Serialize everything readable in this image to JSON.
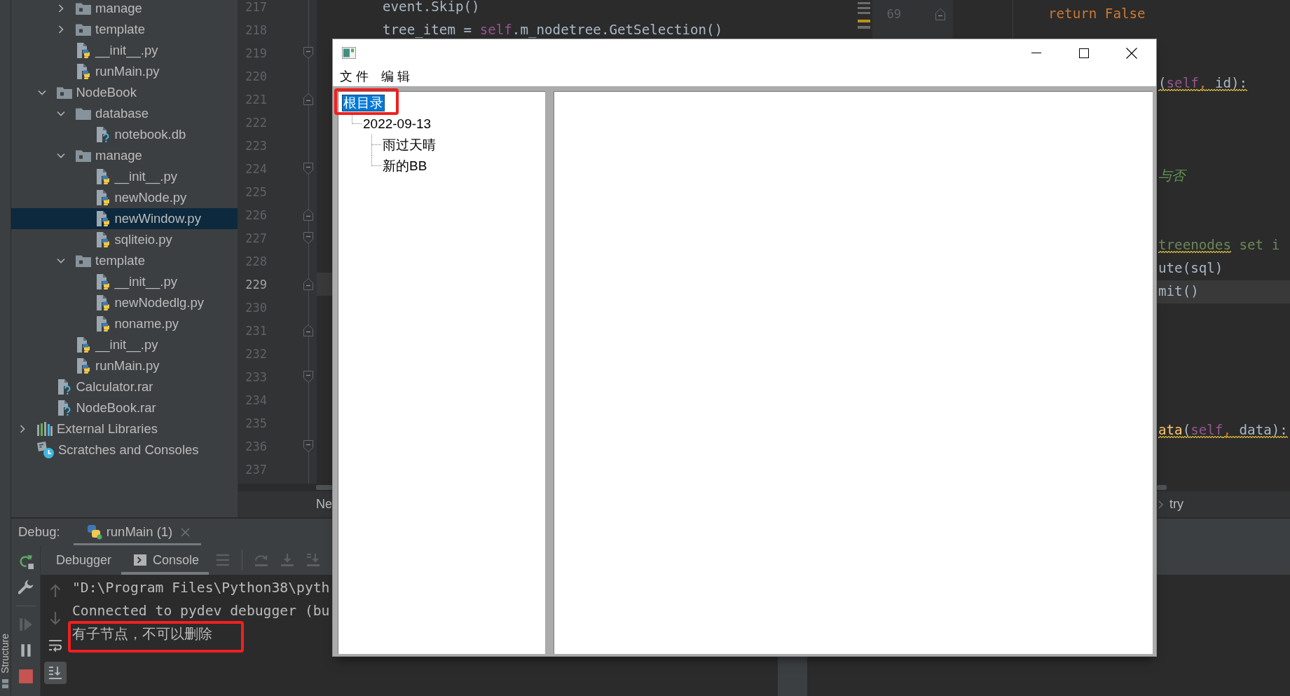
{
  "side_tab": "Structure",
  "project_tree": {
    "items": [
      {
        "children": [
          {
            "children": [
              {
                "label": "manage",
                "kind": "package",
                "expanded": false,
                "selected": false
              },
              {
                "label": "template",
                "kind": "package",
                "expanded": false,
                "selected": false
              },
              {
                "label": "__init__.py",
                "kind": "python",
                "selected": false
              },
              {
                "label": "runMain.py",
                "kind": "python",
                "selected": false
              }
            ]
          },
          {
            "label": "NodeBook",
            "kind": "package",
            "expanded": true,
            "selected": false,
            "children": [
              {
                "label": "database",
                "kind": "folder",
                "expanded": true,
                "selected": false,
                "children": [
                  {
                    "label": "notebook.db",
                    "kind": "unknown",
                    "selected": false
                  }
                ]
              },
              {
                "label": "manage",
                "kind": "package",
                "expanded": true,
                "selected": false,
                "children": [
                  {
                    "label": "__init__.py",
                    "kind": "python",
                    "selected": false
                  },
                  {
                    "label": "newNode.py",
                    "kind": "python",
                    "selected": false
                  },
                  {
                    "label": "newWindow.py",
                    "kind": "python",
                    "selected": true
                  },
                  {
                    "label": "sqliteio.py",
                    "kind": "python",
                    "selected": false
                  }
                ]
              },
              {
                "label": "template",
                "kind": "package",
                "expanded": true,
                "selected": false,
                "children": [
                  {
                    "label": "__init__.py",
                    "kind": "python",
                    "selected": false
                  },
                  {
                    "label": "newNodedlg.py",
                    "kind": "python",
                    "selected": false
                  },
                  {
                    "label": "noname.py",
                    "kind": "python",
                    "selected": false
                  }
                ]
              },
              {
                "label": "__init__.py",
                "kind": "python",
                "selected": false
              },
              {
                "label": "runMain.py",
                "kind": "python",
                "selected": false
              }
            ]
          },
          {
            "label": "Calculator.rar",
            "kind": "unknown",
            "selected": false
          },
          {
            "label": "NodeBook.rar",
            "kind": "unknown",
            "selected": false
          }
        ]
      },
      {
        "label": "External Libraries",
        "kind": "libraries",
        "expanded": false,
        "selected": false
      },
      {
        "label": "Scratches and Consoles",
        "kind": "scratches",
        "selected": false
      }
    ]
  },
  "editor": {
    "lines": [
      {
        "number": "217",
        "current": false,
        "kind": "plain",
        "tokens": [
          {
            "text": "event.Skip()",
            "kind": "plain"
          }
        ]
      },
      {
        "number": "218",
        "current": false,
        "kind": "plain",
        "tokens": [
          {
            "text": "tree_item = ",
            "kind": "plain"
          },
          {
            "text": "self",
            "kind": "self"
          },
          {
            "text": ".m_nodetree.GetSelection()",
            "kind": "plain"
          }
        ]
      },
      {
        "number": "219",
        "current": false,
        "kind": "fold-start"
      },
      {
        "number": "220",
        "current": false,
        "kind": "plain"
      },
      {
        "number": "221",
        "current": false,
        "kind": "fold-end"
      },
      {
        "number": "222",
        "current": false,
        "kind": "plain"
      },
      {
        "number": "223",
        "current": false,
        "kind": "plain"
      },
      {
        "number": "224",
        "current": false,
        "kind": "fold-start"
      },
      {
        "number": "225",
        "current": false,
        "kind": "plain"
      },
      {
        "number": "226",
        "current": false,
        "kind": "fold-end"
      },
      {
        "number": "227",
        "current": false,
        "kind": "fold-start"
      },
      {
        "number": "228",
        "current": false,
        "kind": "plain"
      },
      {
        "number": "229",
        "current": true,
        "kind": "fold-end"
      },
      {
        "number": "230",
        "current": false,
        "kind": "plain"
      },
      {
        "number": "231",
        "current": false,
        "kind": "fold-end"
      },
      {
        "number": "232",
        "current": false,
        "kind": "plain"
      },
      {
        "number": "233",
        "current": false,
        "kind": "fold-start"
      },
      {
        "number": "234",
        "current": false,
        "kind": "plain"
      },
      {
        "number": "235",
        "current": false,
        "kind": "plain"
      },
      {
        "number": "236",
        "current": false,
        "kind": "fold-start"
      },
      {
        "number": "237",
        "current": false,
        "kind": "plain"
      }
    ],
    "breadcrumb": "Ne"
  },
  "right_editor": {
    "lines": [
      {
        "number": "69",
        "current": false,
        "kind": "fold-end",
        "tokens": [
          {
            "text": "return False",
            "kind": "keyword",
            "warning": false
          }
        ]
      },
      {
        "current": false
      },
      {
        "current": false
      },
      {
        "current": false,
        "tokens": [
          {
            "text": "(",
            "kind": "plain",
            "warning": true
          },
          {
            "text": "self",
            "kind": "self",
            "warning": true
          },
          {
            "text": ",",
            "kind": "punct",
            "warning": true
          },
          {
            "text": " id):",
            "kind": "plain",
            "warning": true
          }
        ]
      },
      {
        "current": false
      },
      {
        "current": false
      },
      {
        "current": false
      },
      {
        "current": false,
        "tokens": [
          {
            "text": "与否",
            "kind": "comment",
            "warning": false
          }
        ]
      },
      {
        "current": false
      },
      {
        "current": false
      },
      {
        "current": false,
        "tokens": [
          {
            "text": "treenodes",
            "kind": "string",
            "warning": true
          },
          {
            "text": " set i",
            "kind": "string",
            "warning": false
          }
        ]
      },
      {
        "current": false,
        "tokens": [
          {
            "text": "ute(sql)",
            "kind": "plain",
            "warning": false
          }
        ]
      },
      {
        "current": true,
        "tokens": [
          {
            "text": "mit()",
            "kind": "plain",
            "warning": false
          }
        ]
      },
      {
        "current": false
      },
      {
        "current": false
      },
      {
        "current": false
      },
      {
        "current": false
      },
      {
        "current": false
      },
      {
        "current": false,
        "tokens": [
          {
            "text": "ata",
            "kind": "func",
            "warning": true
          },
          {
            "text": "(",
            "kind": "plain",
            "warning": true
          },
          {
            "text": "self",
            "kind": "self",
            "warning": true
          },
          {
            "text": ",",
            "kind": "punct",
            "warning": true
          },
          {
            "text": " data):",
            "kind": "plain",
            "warning": true
          }
        ]
      }
    ],
    "breadcrumb": "try"
  },
  "debug": {
    "label": "Debug:",
    "tabs": [
      {
        "label": "runMain (1)",
        "selected": true
      }
    ],
    "side_toolbar": [
      {
        "kind": "rerun",
        "disabled": false
      },
      {
        "kind": "wrench",
        "disabled": false
      },
      {
        "kind": "resume",
        "disabled": true
      },
      {
        "kind": "pause",
        "disabled": false
      },
      {
        "kind": "stop",
        "disabled": false
      }
    ],
    "view_tabs": [
      {
        "label": "Debugger",
        "kind": "debugger",
        "selected": false
      },
      {
        "label": "Console",
        "kind": "console",
        "selected": true
      }
    ],
    "toolbar": [
      {
        "kind": "menu",
        "disabled": true
      },
      {
        "kind": "step-over",
        "disabled": true
      },
      {
        "kind": "step-into",
        "disabled": true
      },
      {
        "kind": "step-into-my-code",
        "disabled": true
      }
    ],
    "console_toolbar": [
      {
        "kind": "up",
        "disabled": true,
        "on": false
      },
      {
        "kind": "down",
        "disabled": true,
        "on": false
      },
      {
        "kind": "wrap",
        "disabled": false,
        "on": false
      },
      {
        "kind": "scroll-end",
        "disabled": false,
        "on": true
      }
    ],
    "console": [
      "\"D:\\Program Files\\Python38\\pyth",
      "Connected to pydev debugger (bu",
      "有子节点，不可以删除"
    ]
  },
  "dialog": {
    "menu": [
      "文 件",
      "编 辑"
    ],
    "tree": [
      {
        "label": "根目录",
        "selected": true,
        "children": [
          {
            "label": "2022-09-13",
            "selected": false,
            "children": [
              {
                "label": "雨过天晴",
                "selected": false
              },
              {
                "label": "新的BB",
                "selected": false
              }
            ]
          }
        ]
      }
    ]
  }
}
